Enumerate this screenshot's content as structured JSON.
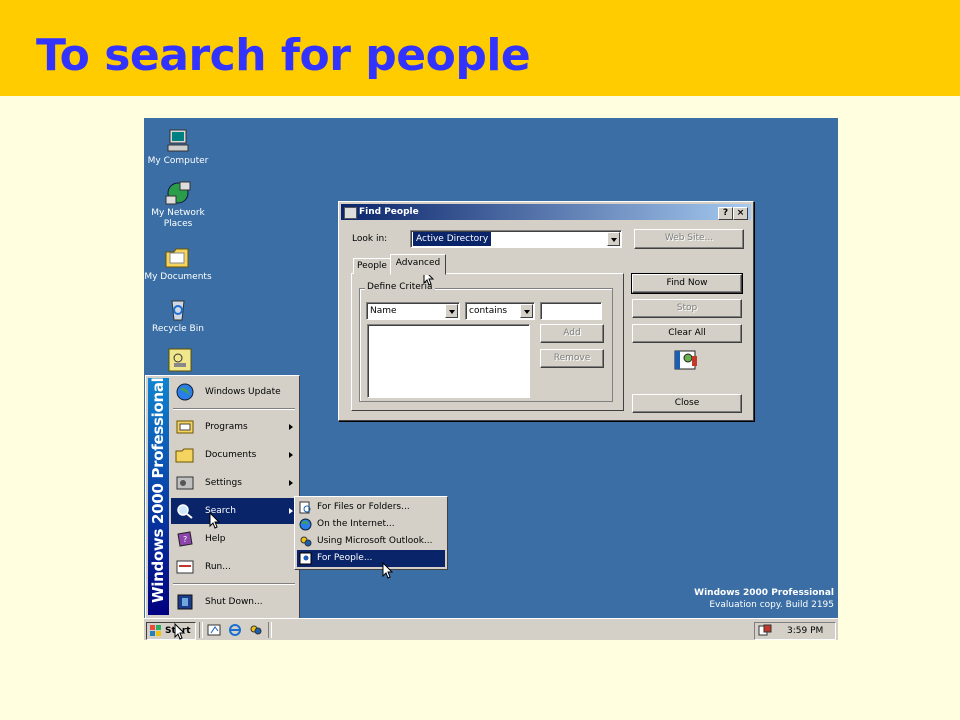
{
  "slide": {
    "title": "To search for people"
  },
  "desktop": {
    "icons": [
      {
        "label": "My Computer",
        "icon": "computer-icon"
      },
      {
        "label": "My Network Places",
        "icon": "network-icon"
      },
      {
        "label": "My Documents",
        "icon": "folder-icon"
      },
      {
        "label": "Recycle Bin",
        "icon": "recycle-bin-icon"
      },
      {
        "label": "",
        "icon": "shortcut-icon"
      }
    ],
    "watermark": {
      "line1": "Windows 2000 Professional",
      "line2": "Evaluation copy. Build 2195"
    }
  },
  "dialog": {
    "title": "Find People",
    "help_btn": "?",
    "close_btn": "×",
    "look_in_label": "Look in:",
    "look_in_value": "Active Directory",
    "web_site_btn": "Web Site...",
    "tabs": [
      "People",
      "Advanced"
    ],
    "group_label": "Define Criteria",
    "field_select": "Name",
    "condition_select": "contains",
    "criteria_value": "",
    "add_btn": "Add",
    "remove_btn": "Remove",
    "find_now_btn": "Find Now",
    "stop_btn": "Stop",
    "clear_all_btn": "Clear All",
    "close_footer_btn": "Close"
  },
  "start_menu": {
    "banner": "Windows 2000 Professional",
    "items": [
      {
        "label": "Windows Update",
        "icon": "globe-icon",
        "submenu": false
      },
      {
        "label": "Programs",
        "icon": "programs-icon",
        "submenu": true
      },
      {
        "label": "Documents",
        "icon": "documents-icon",
        "submenu": true
      },
      {
        "label": "Settings",
        "icon": "settings-icon",
        "submenu": true
      },
      {
        "label": "Search",
        "icon": "search-icon",
        "submenu": true
      },
      {
        "label": "Help",
        "icon": "help-icon",
        "submenu": false
      },
      {
        "label": "Run...",
        "icon": "run-icon",
        "submenu": false
      },
      {
        "label": "Shut Down...",
        "icon": "shutdown-icon",
        "submenu": false
      }
    ]
  },
  "search_submenu": {
    "items": [
      {
        "label": "For Files or Folders...",
        "icon": "files-icon"
      },
      {
        "label": "On the Internet...",
        "icon": "internet-icon"
      },
      {
        "label": "Using Microsoft Outlook...",
        "icon": "outlook-icon"
      },
      {
        "label": "For People...",
        "icon": "people-icon"
      }
    ]
  },
  "taskbar": {
    "start_label": "Start",
    "clock": "3:59 PM"
  },
  "colors": {
    "title_band": "#FFCC00",
    "title_text": "#3333FF",
    "desktop": "#3A6EA5",
    "highlight": "#0A246A"
  }
}
